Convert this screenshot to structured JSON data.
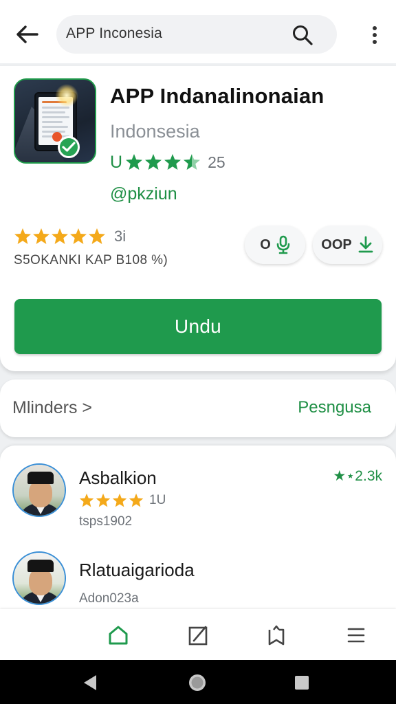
{
  "search": {
    "query": "APP Inconesia"
  },
  "app": {
    "title": "APP Indanalinonaian",
    "subtitle": "Indonsesia",
    "rating_prefix": "U",
    "rating_count": "25",
    "developer": "@pkziun",
    "rating_stars": 3.5,
    "stars2": 5,
    "stars2_count": "3i",
    "meta": "S5OKANKI KAP B108 %)",
    "pill_1_label": "O",
    "pill_2_label": "OOP",
    "download_label": "Undu"
  },
  "section_row": {
    "left_label": "Mlinders >",
    "right_label": "Pesngusa"
  },
  "reviews": [
    {
      "name": "Asbalkion",
      "stars": 4,
      "count": "1U",
      "date": "tsps1902",
      "badge": "★⋆2.3k"
    },
    {
      "name": "Rlatuaigarioda",
      "date": "Adon023a"
    }
  ],
  "bottom_nav": {
    "items": [
      {
        "icon": "home-icon",
        "active": true
      },
      {
        "icon": "edit-icon",
        "active": false
      },
      {
        "icon": "bookmark-icon",
        "active": false
      },
      {
        "icon": "menu-icon",
        "active": false
      }
    ]
  },
  "colors": {
    "accent": "#1f9a4d",
    "star": "#f4a91a",
    "star_green": "#1f9a4d",
    "link": "#1f8f45"
  }
}
